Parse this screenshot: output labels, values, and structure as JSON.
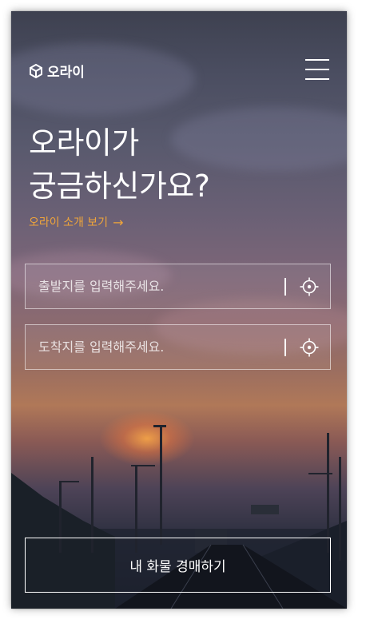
{
  "header": {
    "logo_text": "오라이",
    "logo_icon": "cube-icon",
    "menu_icon": "hamburger-menu-icon"
  },
  "hero": {
    "headline": "오라이가\n궁금하신가요?",
    "intro_link": "오라이 소개 보기",
    "intro_arrow": "→"
  },
  "form": {
    "departure_placeholder": "출발지를 입력해주세요.",
    "destination_placeholder": "도착지를 입력해주세요.",
    "locate_icon": "crosshair-locate-icon"
  },
  "cta": {
    "label": "내 화물 경매하기"
  },
  "colors": {
    "accent": "#f0a53a",
    "text": "#ffffff"
  }
}
